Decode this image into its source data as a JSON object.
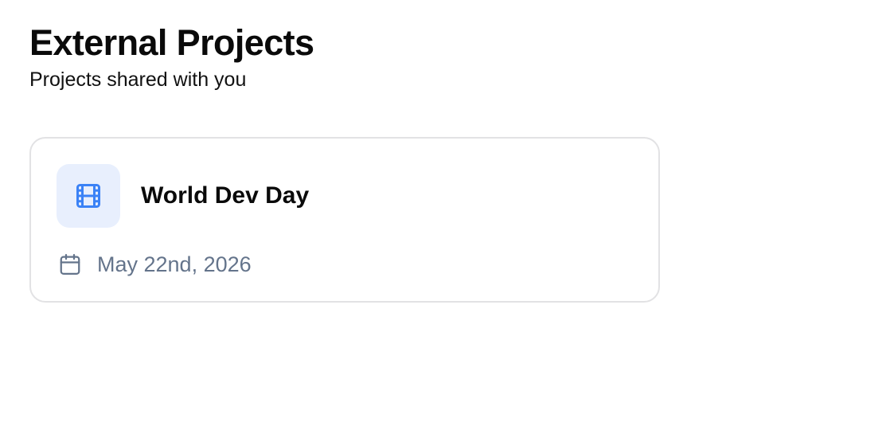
{
  "header": {
    "title": "External Projects",
    "subtitle": "Projects shared with you"
  },
  "projects": [
    {
      "name": "World Dev Day",
      "date": "May 22nd, 2026",
      "icon": "film-icon",
      "date_icon": "calendar-icon"
    }
  ],
  "colors": {
    "accent": "#3b82f6",
    "icon_tile_bg": "#e8effd",
    "muted_text": "#64748b",
    "card_border": "#e2e2e4"
  }
}
